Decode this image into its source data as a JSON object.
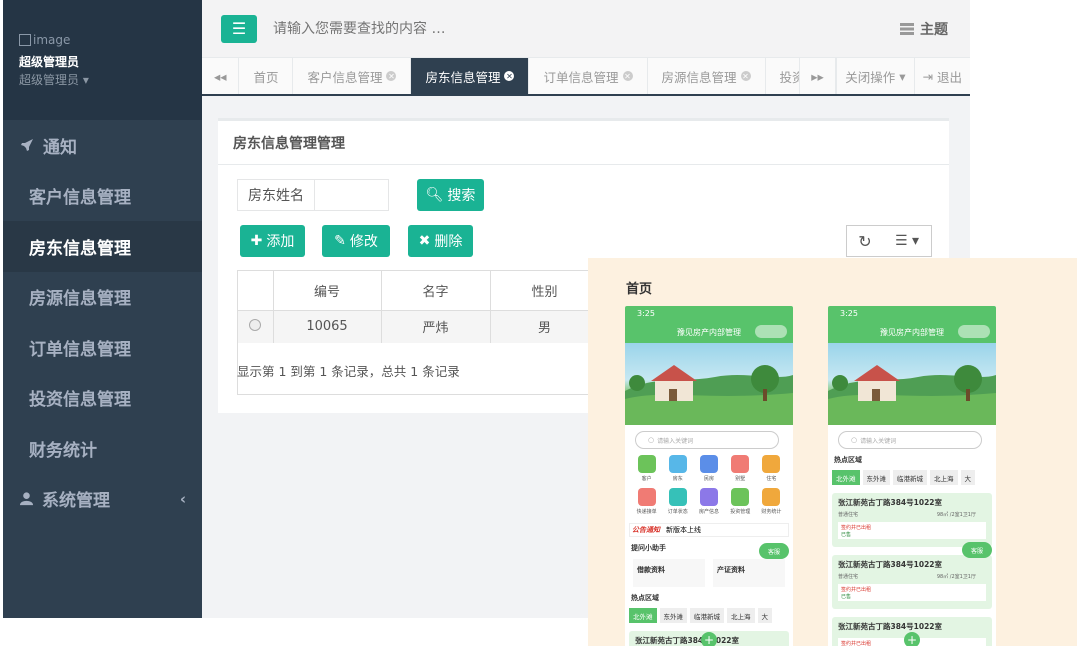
{
  "profile": {
    "image_alt": "image",
    "name": "超级管理员",
    "role": "超级管理员"
  },
  "sidebar": {
    "items": [
      {
        "label": "通知",
        "type": "group"
      },
      {
        "label": "客户信息管理"
      },
      {
        "label": "房东信息管理",
        "active": true
      },
      {
        "label": "房源信息管理"
      },
      {
        "label": "订单信息管理"
      },
      {
        "label": "投资信息管理"
      },
      {
        "label": "财务统计"
      },
      {
        "label": "系统管理",
        "type": "group"
      }
    ]
  },
  "topbar": {
    "search_placeholder": "请输入您需要查找的内容 …",
    "theme_label": "主题"
  },
  "tabs": {
    "items": [
      {
        "label": "首页",
        "closable": false
      },
      {
        "label": "客户信息管理",
        "closable": true
      },
      {
        "label": "房东信息管理",
        "closable": true,
        "active": true
      },
      {
        "label": "订单信息管理",
        "closable": true
      },
      {
        "label": "房源信息管理",
        "closable": true
      },
      {
        "label": "投资信",
        "closable": false
      }
    ],
    "close_ops": "关闭操作",
    "logout": "退出"
  },
  "panel": {
    "title": "房东信息管理管理",
    "filter_label": "房东姓名",
    "search_button": "搜索",
    "add_button": "添加",
    "edit_button": "修改",
    "delete_button": "删除"
  },
  "table": {
    "columns": [
      "编号",
      "名字",
      "性别"
    ],
    "rows": [
      {
        "id": "10065",
        "name": "严炜",
        "gender": "男"
      }
    ],
    "pager": "显示第 1 到第 1 条记录，总共 1 条记录"
  },
  "overlay": {
    "title": "首页",
    "phone": {
      "time": "3:25",
      "app_title": "豫见房产内部管理",
      "search_placeholder": "请输入关键词",
      "icons": [
        {
          "label": "客户",
          "color": "#6cc35a"
        },
        {
          "label": "房东",
          "color": "#57b7e8"
        },
        {
          "label": "民房",
          "color": "#5b8ee8"
        },
        {
          "label": "别墅",
          "color": "#f07b74"
        },
        {
          "label": "住宅",
          "color": "#f0a83c"
        },
        {
          "label": "快递接单",
          "color": "#f07b74"
        },
        {
          "label": "订单状态",
          "color": "#36c1b8"
        },
        {
          "label": "房产信息",
          "color": "#8c78e8"
        },
        {
          "label": "投资管理",
          "color": "#6cc35a"
        },
        {
          "label": "财务统计",
          "color": "#f0a83c"
        }
      ],
      "notice_tag": "公告通知",
      "notice_text": "新版本上线",
      "helper_title": "提问小助手",
      "card1": "借款资料",
      "card2": "产证资料",
      "service": "客服",
      "hot_title": "热点区域",
      "chips": [
        "北外滩",
        "东外滩",
        "临港新城",
        "北上海",
        "大"
      ],
      "listing_title": "张江新苑古丁路384号1022室",
      "listing_type": "普通住宅",
      "listing_area": "98㎡ /2室1卫1厅",
      "listing_note": "签约并已出租",
      "listing_status": "已售",
      "listing_partial": "张江新苑古丁路384号1022室"
    }
  }
}
